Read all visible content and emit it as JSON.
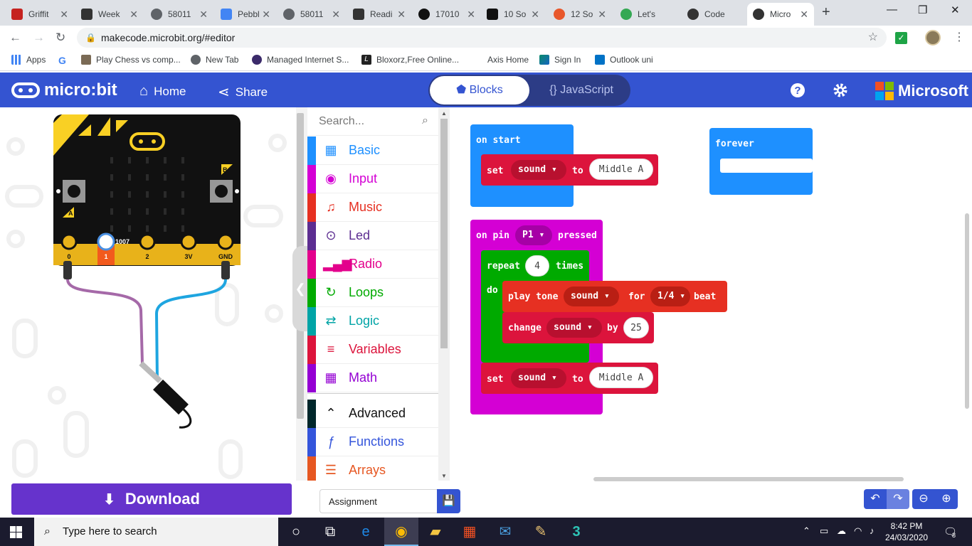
{
  "browser": {
    "tabs": [
      {
        "title": "Griffit",
        "icon": "document-icon",
        "color": "#c5221f"
      },
      {
        "title": "Week",
        "icon": "blackboard-icon",
        "color": "#333333"
      },
      {
        "title": "58011",
        "icon": "globe-icon",
        "color": "#5f6368"
      },
      {
        "title": "Pebbl",
        "icon": "pebble-icon",
        "color": "#4285f4"
      },
      {
        "title": "58011",
        "icon": "globe-icon",
        "color": "#5f6368"
      },
      {
        "title": "Readi",
        "icon": "blackboard-icon",
        "color": "#333333"
      },
      {
        "title": "17010",
        "icon": "github-icon",
        "color": "#111111"
      },
      {
        "title": "10 So",
        "icon": "medium-icon",
        "color": "#111111"
      },
      {
        "title": "12 So",
        "icon": "a-icon",
        "color": "#e8572b"
      },
      {
        "title": "Let's",
        "icon": "link-icon",
        "color": "#34a853"
      },
      {
        "title": "Code",
        "icon": "microbit-icon",
        "color": "#333333"
      },
      {
        "title": "Micro",
        "icon": "microbit-icon",
        "color": "#333333",
        "active": true
      }
    ],
    "new_tab": "+",
    "url": "makecode.microbit.org/#editor",
    "bookmarks": [
      {
        "label": "Apps",
        "icon": "apps-icon"
      },
      {
        "label": "",
        "icon": "google-icon"
      },
      {
        "label": "Play Chess vs comp...",
        "icon": "chess-icon"
      },
      {
        "label": "New Tab",
        "icon": "globe-icon"
      },
      {
        "label": "Managed Internet S...",
        "icon": "shield-icon"
      },
      {
        "label": "Bloxorz,Free Online...",
        "icon": "bloxorz-icon"
      },
      {
        "label": "Axis Home",
        "icon": "axis-icon"
      },
      {
        "label": "Sign In",
        "icon": "sign-in-icon"
      },
      {
        "label": "Outlook uni",
        "icon": "outlook-icon"
      }
    ]
  },
  "header": {
    "logo": "micro:bit",
    "home": "Home",
    "share": "Share",
    "blocks_tab": "Blocks",
    "js_tab": "JavaScript",
    "brand": "Microsoft"
  },
  "simulator": {
    "pins": [
      "0",
      "1",
      "2",
      "3V",
      "GND"
    ],
    "pin_value": "1007",
    "button_a": "A",
    "button_b": "B"
  },
  "toolbox": {
    "search_placeholder": "Search...",
    "categories": [
      {
        "label": "Basic",
        "color": "#1e90ff",
        "icon": "grid-icon"
      },
      {
        "label": "Input",
        "color": "#d400d4",
        "icon": "target-icon"
      },
      {
        "label": "Music",
        "color": "#e63022",
        "icon": "headphones-icon"
      },
      {
        "label": "Led",
        "color": "#5c2d91",
        "icon": "toggle-icon"
      },
      {
        "label": "Radio",
        "color": "#e3008c",
        "icon": "signal-icon"
      },
      {
        "label": "Loops",
        "color": "#00aa00",
        "icon": "refresh-icon"
      },
      {
        "label": "Logic",
        "color": "#00a4a6",
        "icon": "shuffle-icon"
      },
      {
        "label": "Variables",
        "color": "#dc143c",
        "icon": "list-icon"
      },
      {
        "label": "Math",
        "color": "#9400d3",
        "icon": "calculator-icon"
      }
    ],
    "advanced": [
      {
        "label": "Advanced",
        "color": "#00272b",
        "icon": "chevron-up-icon"
      },
      {
        "label": "Functions",
        "color": "#3455db",
        "icon": "function-icon"
      },
      {
        "label": "Arrays",
        "color": "#e65722",
        "icon": "ordered-list-icon"
      }
    ]
  },
  "workspace": {
    "on_start": "on start",
    "set1": {
      "kw": "set",
      "var": "sound",
      "to": "to",
      "value": "Middle A"
    },
    "forever": "forever",
    "on_pin": {
      "kw": "on pin",
      "pin": "P1",
      "event": "pressed"
    },
    "repeat": {
      "kw": "repeat",
      "count": "4",
      "times": "times",
      "do": "do"
    },
    "play_tone": {
      "kw": "play tone",
      "var": "sound",
      "for": "for",
      "duration": "1/4",
      "beat": "beat"
    },
    "change": {
      "kw": "change",
      "var": "sound",
      "by": "by",
      "amount": "25"
    },
    "set2": {
      "kw": "set",
      "var": "sound",
      "to": "to",
      "value": "Middle A"
    }
  },
  "bottom": {
    "download": "Download",
    "project_name": "Assignment"
  },
  "taskbar": {
    "search": "Type here to search",
    "time": "8:42 PM",
    "date": "24/03/2020",
    "notifications": "8"
  }
}
